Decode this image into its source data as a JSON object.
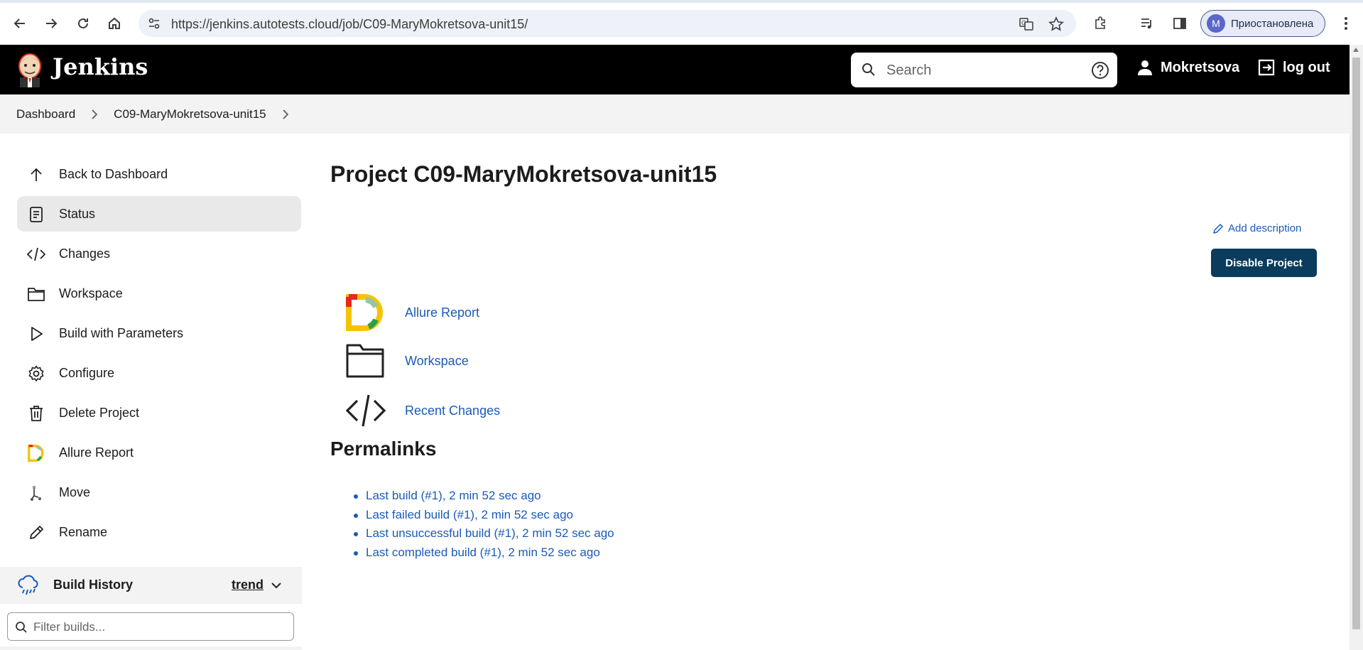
{
  "browser": {
    "url": "https://jenkins.autotests.cloud/job/C09-MaryMokretsova-unit15/",
    "profile_initial": "M",
    "profile_label": "Приостановлена"
  },
  "header": {
    "app_title": "Jenkins",
    "search_placeholder": "Search",
    "user_name": "Mokretsova",
    "logout_label": "log out"
  },
  "breadcrumb": {
    "items": [
      "Dashboard",
      "C09-MaryMokretsova-unit15"
    ]
  },
  "sidebar": {
    "items": [
      {
        "label": "Back to Dashboard",
        "icon": "arrow-up-icon"
      },
      {
        "label": "Status",
        "icon": "document-icon",
        "active": true
      },
      {
        "label": "Changes",
        "icon": "code-icon"
      },
      {
        "label": "Workspace",
        "icon": "folder-icon"
      },
      {
        "label": "Build with Parameters",
        "icon": "play-icon"
      },
      {
        "label": "Configure",
        "icon": "gear-icon"
      },
      {
        "label": "Delete Project",
        "icon": "trash-icon"
      },
      {
        "label": "Allure Report",
        "icon": "allure-icon"
      },
      {
        "label": "Move",
        "icon": "move-icon"
      },
      {
        "label": "Rename",
        "icon": "pencil-icon"
      }
    ],
    "build_history": {
      "title": "Build History",
      "trend_label": "trend",
      "filter_placeholder": "Filter builds..."
    }
  },
  "main": {
    "title": "Project C09-MaryMokretsova-unit15",
    "add_description": "Add description",
    "disable_button": "Disable Project",
    "links": [
      "Allure Report",
      "Workspace",
      "Recent Changes"
    ],
    "permalinks_title": "Permalinks",
    "permalinks": [
      "Last build (#1), 2 min 52 sec ago",
      "Last failed build (#1), 2 min 52 sec ago",
      "Last unsuccessful build (#1), 2 min 52 sec ago",
      "Last completed build (#1), 2 min 52 sec ago"
    ]
  },
  "colors": {
    "header_bg": "#000000",
    "link": "#1a5bb8",
    "primary_button": "#0b3c5d"
  }
}
